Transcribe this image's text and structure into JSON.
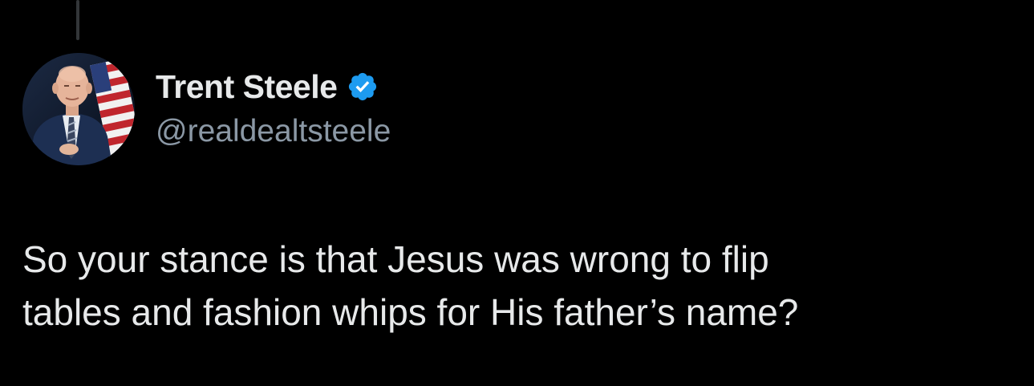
{
  "author": {
    "display_name": "Trent Steele",
    "handle": "@realdealtsteele",
    "verified": true,
    "avatar_icon": "profile-photo"
  },
  "tweet": {
    "text_line_1": "So your stance is that Jesus was wrong to flip",
    "text_line_2": "tables and fashion whips for His father’s name?"
  },
  "colors": {
    "background": "#000000",
    "text_primary": "#e7e9ea",
    "text_secondary": "#8b98a5",
    "verified_badge": "#1d9bf0"
  }
}
